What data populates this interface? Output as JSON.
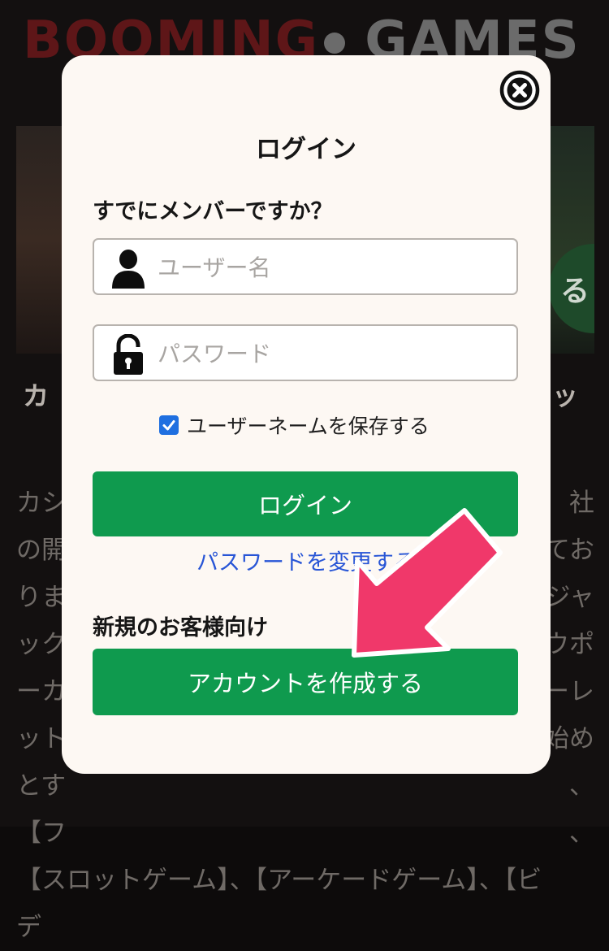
{
  "background": {
    "logo_red": "BOOMING",
    "logo_gray": "GAMES",
    "heading_left": "カ",
    "heading_right": "ッ",
    "badge_right": "る",
    "text_rows": [
      [
        "カシ",
        "社"
      ],
      [
        "の開",
        "てお"
      ],
      [
        "りま",
        "ジャ"
      ],
      [
        "ック",
        "ウポ"
      ],
      [
        "ーカ",
        "ーレ"
      ],
      [
        "ット",
        "始め"
      ],
      [
        "とす",
        "、"
      ],
      [
        "【フ",
        "、"
      ]
    ],
    "text_full_line": "【スロットゲーム】、【アーケードゲーム】、【ビ",
    "text_last_line": "デ"
  },
  "modal": {
    "title": "ログイン",
    "member_heading": "すでにメンバーですか？",
    "username_placeholder": "ユーザー名",
    "password_placeholder": "パスワード",
    "remember_label": "ユーザーネームを保存する",
    "remember_checked": true,
    "login_button": "ログイン",
    "change_password_link": "パスワードを変更する",
    "new_customer_heading": "新規のお客様向け",
    "create_account_button": "アカウントを作成する"
  },
  "colors": {
    "modal_bg": "#fdf8f3",
    "button_green": "#0f9a4e",
    "link_blue": "#2855d6",
    "arrow_pink": "#f0386a"
  },
  "icons": [
    "close-icon",
    "user-icon",
    "lock-icon",
    "checkbox-checked-icon",
    "pointer-arrow-icon"
  ]
}
